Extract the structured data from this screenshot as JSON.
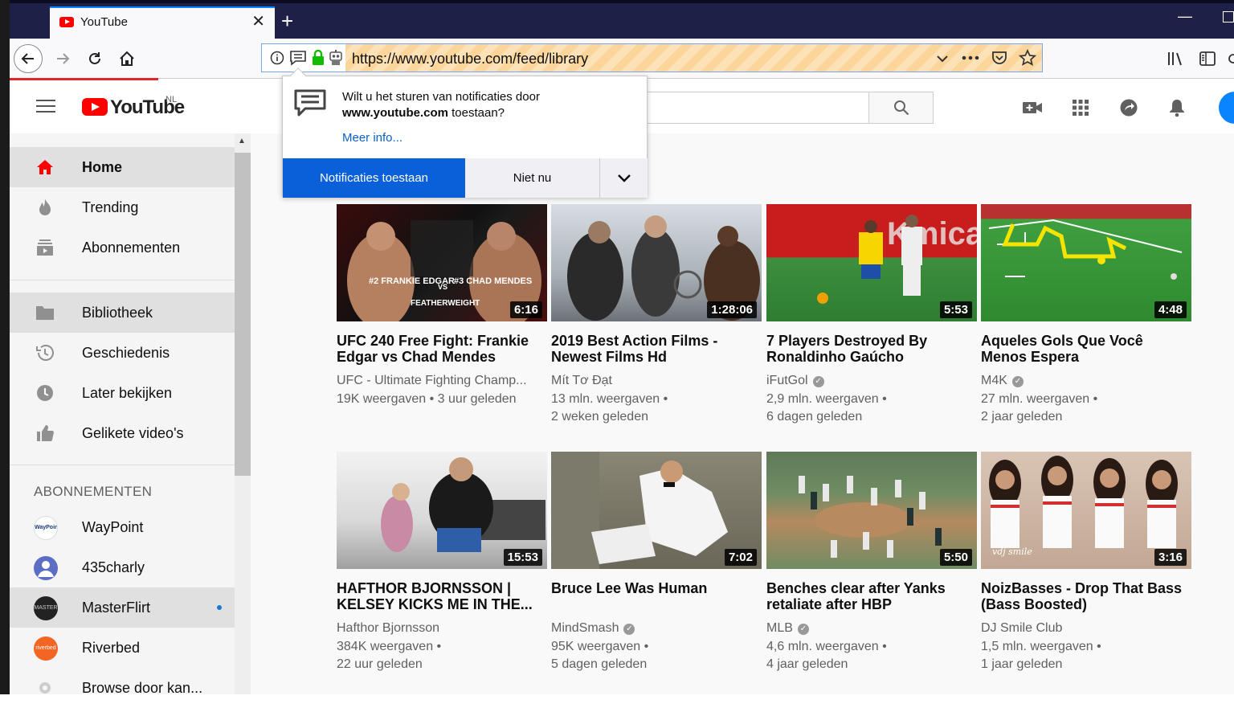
{
  "browser": {
    "tab_title": "YouTube",
    "url": "https://www.youtube.com/feed/library"
  },
  "youtube": {
    "logo_text": "YouTube",
    "country_code": "NL"
  },
  "popup": {
    "message_part1": "Wilt u het sturen van notificaties door ",
    "message_domain": "www.youtube.com",
    "message_part2": " toestaan?",
    "more_info": "Meer info...",
    "allow_label": "Notificaties toestaan",
    "not_now_label": "Niet nu"
  },
  "sidebar": {
    "items": [
      {
        "label": "Home",
        "icon": "home-icon"
      },
      {
        "label": "Trending",
        "icon": "flame-icon"
      },
      {
        "label": "Abonnementen",
        "icon": "subscriptions-icon"
      },
      {
        "label": "Bibliotheek",
        "icon": "folder-icon"
      },
      {
        "label": "Geschiedenis",
        "icon": "history-icon"
      },
      {
        "label": "Later bekijken",
        "icon": "clock-icon"
      },
      {
        "label": "Gelikete video's",
        "icon": "thumbs-up-icon"
      }
    ],
    "subscriptions_header": "ABONNEMENTEN",
    "channels": [
      {
        "label": "WayPoint"
      },
      {
        "label": "435charly"
      },
      {
        "label": "MasterFlirt"
      },
      {
        "label": "Riverbed"
      },
      {
        "label": "Browse door kan..."
      }
    ]
  },
  "videos": [
    {
      "title": "UFC 240 Free Fight: Frankie Edgar vs Chad Mendes",
      "channel": "UFC - Ultimate Fighting Champ...",
      "verified": false,
      "meta1": "19K weergaven • 3 uur geleden",
      "meta2": "",
      "duration": "6:16"
    },
    {
      "title": "2019 Best Action Films - Newest Films Hd",
      "channel": "Mít Tơ Đạt",
      "verified": false,
      "meta1": "13 mln. weergaven •",
      "meta2": "2 weken geleden",
      "duration": "1:28:06"
    },
    {
      "title": "7 Players Destroyed By Ronaldinho Gaúcho",
      "channel": "iFutGol",
      "verified": true,
      "meta1": "2,9 mln. weergaven •",
      "meta2": "6 dagen geleden",
      "duration": "5:53"
    },
    {
      "title": "Aqueles Gols Que Você Menos Espera",
      "channel": "M4K",
      "verified": true,
      "meta1": "27 mln. weergaven •",
      "meta2": "2 jaar geleden",
      "duration": "4:48"
    },
    {
      "title": "HAFTHOR BJORNSSON | KELSEY KICKS ME IN THE...",
      "channel": "Hafthor Bjornsson",
      "verified": false,
      "meta1": "384K weergaven •",
      "meta2": "22 uur geleden",
      "duration": "15:53"
    },
    {
      "title": "Bruce Lee Was Human",
      "channel": "MindSmash",
      "verified": true,
      "meta1": "95K weergaven •",
      "meta2": "5 dagen geleden",
      "duration": "7:02"
    },
    {
      "title": "Benches clear after Yanks retaliate after HBP",
      "channel": "MLB",
      "verified": true,
      "meta1": "4,6 mln. weergaven •",
      "meta2": "4 jaar geleden",
      "duration": "5:50"
    },
    {
      "title": "NoizBasses - Drop That Bass (Bass Boosted)",
      "channel": "DJ Smile Club",
      "verified": false,
      "meta1": "1,5 mln. weergaven •",
      "meta2": "1 jaar geleden",
      "duration": "3:16"
    }
  ],
  "thumb_text": {
    "ufc_left_name": "#2 FRANKIE EDGAR",
    "ufc_right_name": "#3 CHAD MENDES",
    "ufc_vs": "VS",
    "ufc_class": "FEATHERWEIGHT",
    "noiz_shirt": "vdj smile"
  }
}
